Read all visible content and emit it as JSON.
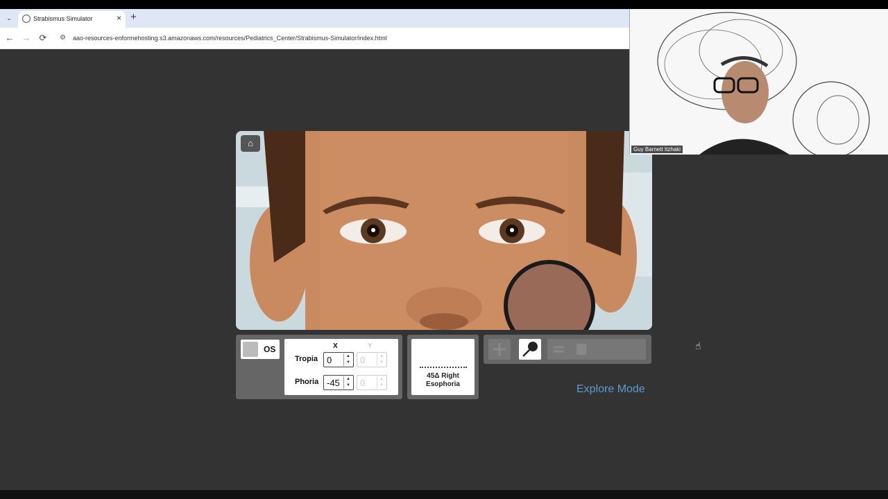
{
  "browser": {
    "tab_title": "Strabismus Simulator",
    "tab_close": "×",
    "new_tab": "+",
    "tab_dropdown": "⌄",
    "url": "aao-resources-enformehosting.s3.amazonaws.com/resources/Pediatrics_Center/Strabismus-Simulator/index.html",
    "back": "←",
    "forward": "→",
    "reload": "⟳",
    "site_info": "⚙"
  },
  "webcam": {
    "name": "Guy Barnett Itzhaki"
  },
  "simulator": {
    "home_icon": "⌂",
    "eye_label": "OS",
    "col_x": "X",
    "col_y": "Y",
    "tropia_label": "Tropia",
    "phoria_label": "Phoria",
    "tropia_x": "0",
    "tropia_y": "0",
    "phoria_x": "-45",
    "phoria_y": "0",
    "result_line1": "45Δ Right",
    "result_line2": "Esophoria",
    "mode_label": "Explore Mode",
    "spin_up": "▲",
    "spin_down": "▼"
  }
}
